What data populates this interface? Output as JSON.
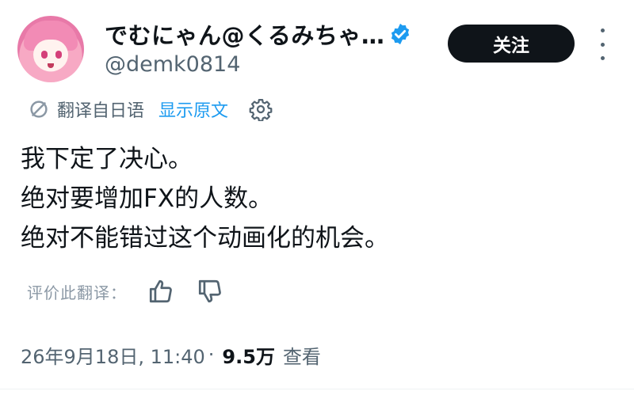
{
  "author": {
    "display_name": "でむにゃん@くるみちゃ…",
    "handle": "@demk0814",
    "verified": true,
    "avatar_icon": "anime-girl-avatar"
  },
  "actions": {
    "follow_label": "关注",
    "more_icon": "more-vertical-icon"
  },
  "translation": {
    "label": "翻译自日语",
    "show_original": "显示原文",
    "settings_icon": "gear-icon"
  },
  "tweet": {
    "lines": [
      "我下定了决心。",
      "绝对要增加FX的人数。",
      "绝对不能错过这个动画化的机会。"
    ]
  },
  "rating": {
    "label": "评价此翻译：",
    "thumbs_up_icon": "thumbs-up-icon",
    "thumbs_down_icon": "thumbs-down-icon"
  },
  "meta": {
    "datetime": "26年9月18日, 11:40",
    "separator": "·",
    "views_count": "9.5万",
    "views_label": "查看"
  },
  "colors": {
    "accent": "#1d9bf0",
    "text": "#0f1419",
    "muted": "#536471",
    "button_bg": "#0f1419"
  }
}
